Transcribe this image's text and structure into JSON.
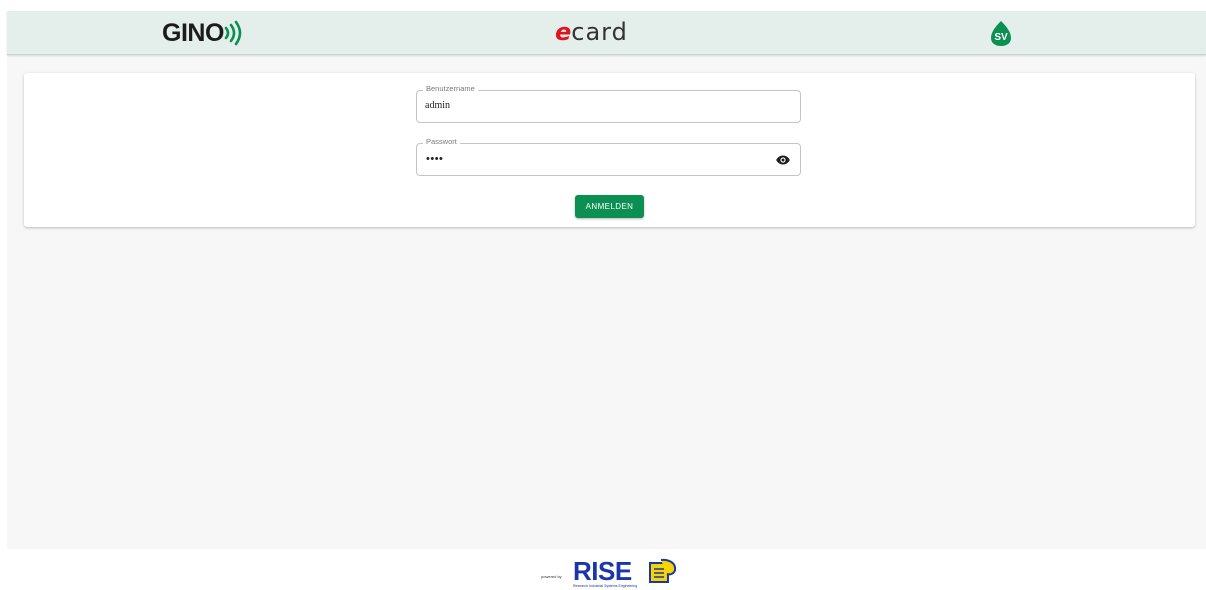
{
  "header": {
    "gino_logo_text": "GINO",
    "ecard_logo_e": "e",
    "ecard_logo_rest": "card",
    "sv_logo_text": "SV"
  },
  "login_form": {
    "username_label": "Benutzername",
    "username_value": "admin",
    "password_label": "Passwort",
    "password_value": "••••",
    "submit_label": "ANMELDEN"
  },
  "footer": {
    "powered_by": "powered by",
    "brand": "RISE",
    "tagline": "Research Industrial Systems Engineering"
  },
  "colors": {
    "header_bg": "#e4efec",
    "primary_green": "#0c8f52",
    "ecard_red": "#e0141e",
    "rise_blue": "#1a36a8"
  },
  "icons": {
    "password_toggle": "eye-icon",
    "gino_waves": "signal-waves-icon",
    "sv_leaf": "leaf-icon"
  }
}
